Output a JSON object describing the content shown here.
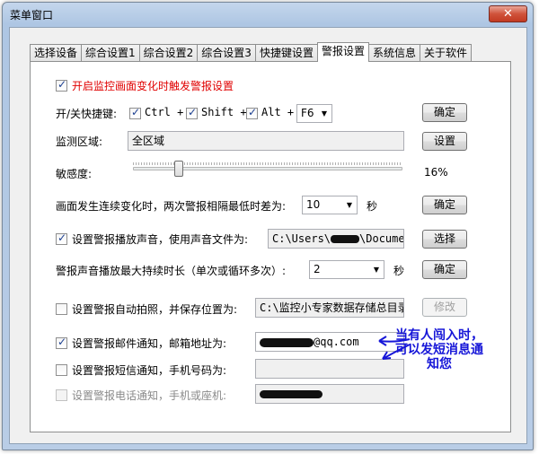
{
  "window": {
    "title": "菜单窗口",
    "close_label": "✕"
  },
  "tabs": [
    {
      "label": "选择设备",
      "active": false
    },
    {
      "label": "综合设置1",
      "active": false
    },
    {
      "label": "综合设置2",
      "active": false
    },
    {
      "label": "综合设置3",
      "active": false
    },
    {
      "label": "快捷键设置",
      "active": false
    },
    {
      "label": "警报设置",
      "active": true
    },
    {
      "label": "系统信息",
      "active": false
    },
    {
      "label": "关于软件",
      "active": false
    }
  ],
  "alarm": {
    "enable_label": "开启监控画面变化时触发警报设置",
    "hotkey": {
      "label": "开/关快捷键:",
      "ctrl": "Ctrl +",
      "shift": "Shift +",
      "alt": "Alt +",
      "key": "F6",
      "confirm": "确定"
    },
    "region": {
      "label": "监测区域:",
      "value": "全区域",
      "button": "设置"
    },
    "sensitivity": {
      "label": "敏感度:",
      "value_text": "16%",
      "value": 0.16
    },
    "interval": {
      "label": "画面发生连续变化时，两次警报相隔最低时差为:",
      "value": "10",
      "unit": "秒",
      "confirm": "确定"
    },
    "sound": {
      "label": "设置警报播放声音，使用声音文件为:",
      "value": "C:\\Users\\",
      "value_tail": "\\Documents",
      "button": "选择"
    },
    "duration": {
      "label": "警报声音播放最大持续时长（单次或循环多次）:",
      "value": "2",
      "unit": "秒",
      "confirm": "确定"
    },
    "snapshot": {
      "label": "设置警报自动拍照，并保存位置为:",
      "value": "C:\\监控小专家数据存储总目录\\",
      "button": "修改"
    },
    "email": {
      "label": "设置警报邮件通知，邮箱地址为:",
      "value": "@qq.com"
    },
    "sms": {
      "label": "设置警报短信通知，手机号码为:"
    },
    "phone": {
      "label": "设置警报电话通知，手机或座机:"
    }
  },
  "annotation": {
    "line1": "当有人闯入时，",
    "line2": "可以发短消息通",
    "line3": "知您"
  },
  "colors": {
    "accent_red": "#e00000",
    "annotation_blue": "#1616d8"
  }
}
